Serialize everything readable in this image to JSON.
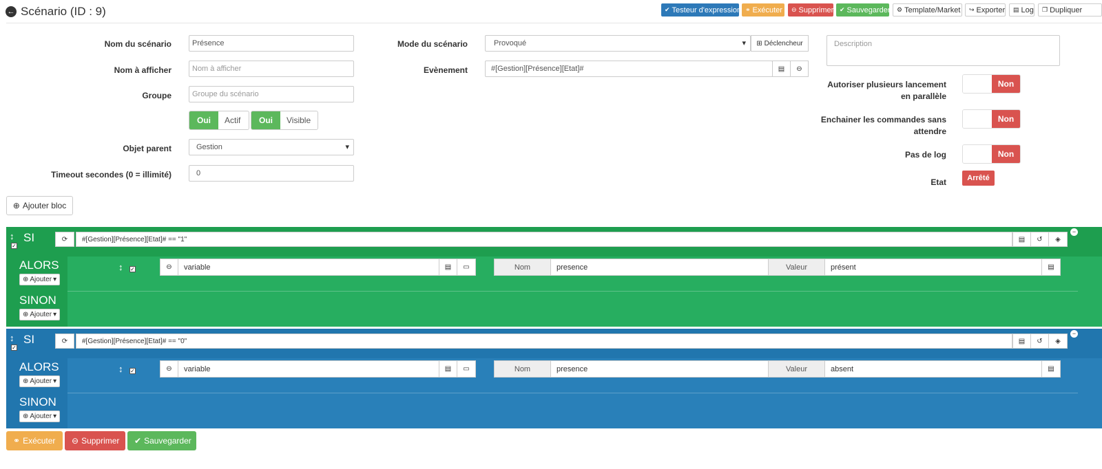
{
  "header": {
    "title": "Scénario (ID : 9)",
    "buttons": {
      "tester": "Testeur d'expression",
      "execute": "Exécuter",
      "delete": "Supprimer",
      "save": "Sauvegarder",
      "template": "Template/Market",
      "export": "Exporter",
      "log": "Log",
      "duplicate": "Dupliquer"
    }
  },
  "form": {
    "name_label": "Nom du scénario",
    "name_value": "Présence",
    "display_label": "Nom à afficher",
    "display_placeholder": "Nom à afficher",
    "group_label": "Groupe",
    "group_placeholder": "Groupe du scénario",
    "active_on": "Oui",
    "active_label": "Actif",
    "visible_on": "Oui",
    "visible_label": "Visible",
    "parent_label": "Objet parent",
    "parent_value": "Gestion",
    "timeout_label": "Timeout secondes (0 = illimité)",
    "timeout_value": "0",
    "mode_label": "Mode du scénario",
    "mode_value": "Provoqué",
    "trigger_button": "Déclencheur",
    "event_label": "Evènement",
    "event_value": "#[Gestion][Présence][Etat]#",
    "description_placeholder": "Description",
    "parallel_label_1": "Autoriser plusieurs lancement",
    "parallel_label_2": "en parallèle",
    "parallel_value": "Non",
    "chain_label_1": "Enchainer les commandes sans",
    "chain_label_2": "attendre",
    "chain_value": "Non",
    "nolog_label": "Pas de log",
    "nolog_value": "Non",
    "state_label": "Etat",
    "state_value": "Arrêté"
  },
  "add_block": "Ajouter bloc",
  "blocks": [
    {
      "if_label": "SI",
      "condition": "#[Gestion][Présence][Etat]# == \"1\"",
      "then_label": "ALORS",
      "else_label": "SINON",
      "add_label": "Ajouter",
      "action_type": "variable",
      "name_label": "Nom",
      "name_value": "presence",
      "value_label": "Valeur",
      "value_value": "présent"
    },
    {
      "if_label": "SI",
      "condition": "#[Gestion][Présence][Etat]# == \"0\"",
      "then_label": "ALORS",
      "else_label": "SINON",
      "add_label": "Ajouter",
      "action_type": "variable",
      "name_label": "Nom",
      "name_value": "presence",
      "value_label": "Valeur",
      "value_value": "absent"
    }
  ],
  "footer": {
    "execute": "Exécuter",
    "delete": "Supprimer",
    "save": "Sauvegarder"
  },
  "colors": {
    "block1_dark": "#1e9e4f",
    "block1": "#27ae60",
    "block2_dark": "#2176ae",
    "block2": "#2980b9"
  }
}
